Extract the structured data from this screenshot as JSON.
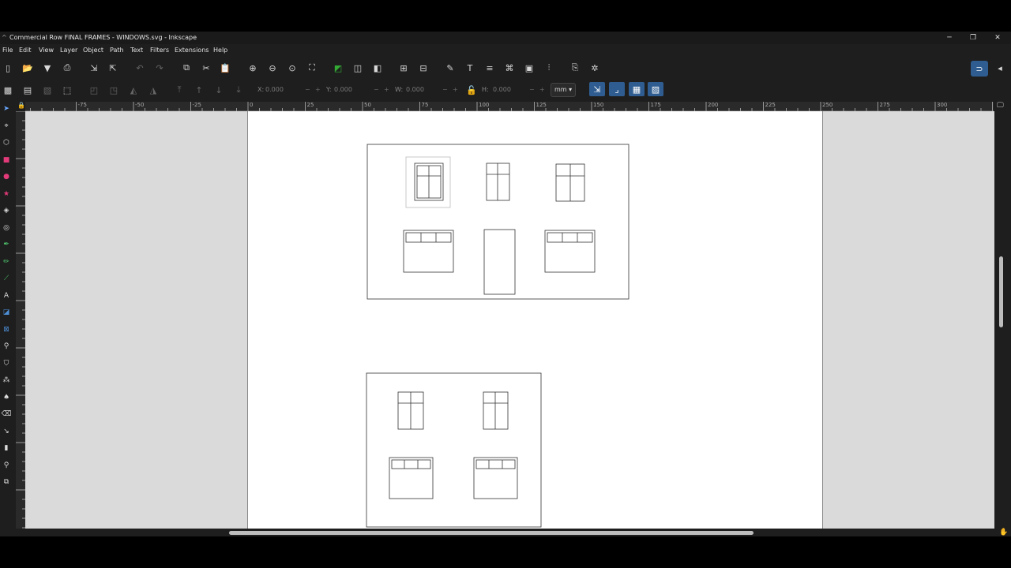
{
  "window": {
    "title": "Commercial Row FINAL FRAMES - WINDOWS.svg - Inkscape",
    "app_glyph": "^",
    "minimize": "─",
    "maximize": "❐",
    "close": "✕"
  },
  "menu": [
    "File",
    "Edit",
    "View",
    "Layer",
    "Object",
    "Path",
    "Text",
    "Filters",
    "Extensions",
    "Help"
  ],
  "toolbar": {
    "x_label": "X:",
    "x_value": "0.000",
    "y_label": "Y:",
    "y_value": "0.000",
    "w_label": "W:",
    "w_value": "0.000",
    "h_label": "H:",
    "h_value": "0.000",
    "minus": "−",
    "plus": "+",
    "unit": "mm ▾"
  },
  "ruler": {
    "top_labels": [
      "-100",
      "-75",
      "-50",
      "-25",
      "0",
      "25",
      "50",
      "75",
      "100",
      "125",
      "150",
      "175",
      "200",
      "225",
      "250",
      "275",
      "300",
      "325",
      "350",
      "375"
    ]
  },
  "colors": {
    "accent": "#2f5d91",
    "canvas_bg": "#dadada",
    "page_bg": "#ffffff"
  }
}
